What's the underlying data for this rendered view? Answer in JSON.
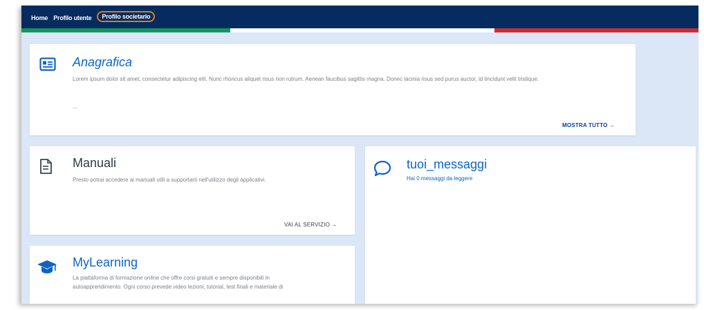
{
  "nav": {
    "items": [
      "Home",
      "Profilo utente",
      "Profilo societario"
    ],
    "active_index": 2
  },
  "anagrafica": {
    "title": "Anagrafica",
    "description": "Lorem ipsum dolor sit amet, consectetur adipiscing elit. Nunc rhoncus aliquet risus non rutrum. Aenean faucibus sagittis magna. Donec lacinia risus sed purus auctor, id tincidunt velit tristique.",
    "ellipsis": "...",
    "link": "MOSTRA TUTTO →",
    "icon": "id-card-icon"
  },
  "manuali": {
    "title": "Manuali",
    "description": "Presto potrai accedere ai manuali utili a supportarti nell'utilizzo degli applicativi.",
    "link": "VAI AL SERVIZIO →",
    "icon": "document-icon"
  },
  "messaggi": {
    "title": "tuoi_messaggi",
    "subtitle": "Hai 0 messaggi da leggere",
    "icon": "chat-bubble-icon"
  },
  "mylearning": {
    "title": "MyLearning",
    "description": "La piattaforma di formazione online che offre corsi gratuiti e sempre disponibili in autoapprendimento. Ogni corso prevede video lezioni, tutorial, test finali e materiale di",
    "icon": "graduation-cap-icon"
  },
  "colors": {
    "header": "#062b5e",
    "accent": "#0e63c8",
    "page_bg": "#dbe7f7",
    "highlight": "#e07b1c"
  }
}
